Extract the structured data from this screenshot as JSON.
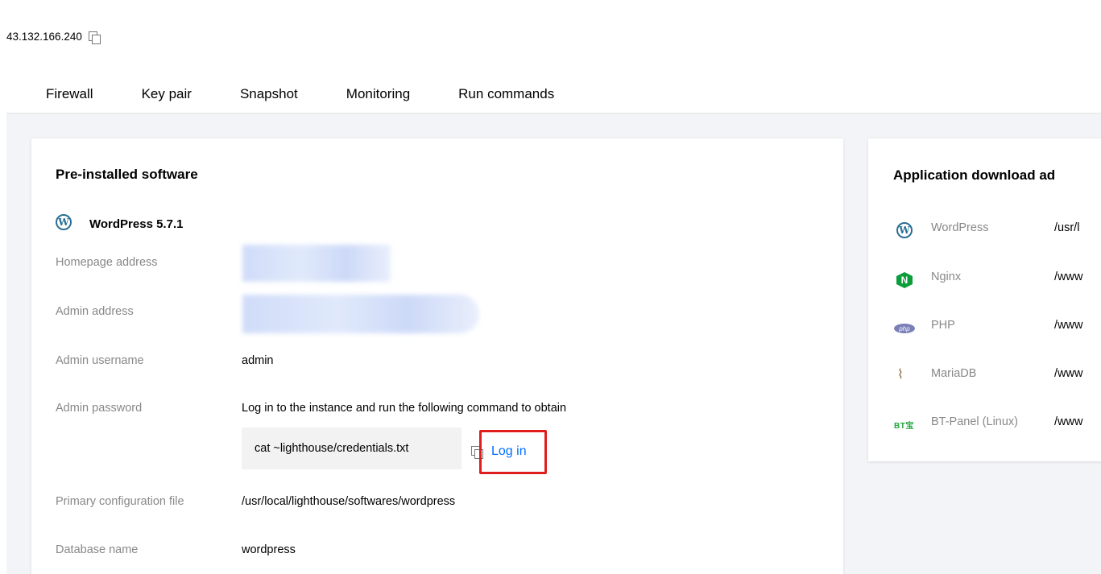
{
  "header": {
    "ip": "43.132.166.240",
    "tabs": [
      "Firewall",
      "Key pair",
      "Snapshot",
      "Monitoring",
      "Run commands"
    ]
  },
  "main": {
    "title": "Pre-installed software",
    "app": "WordPress 5.7.1",
    "labels": {
      "homepage": "Homepage address",
      "admin_address": "Admin address",
      "admin_username": "Admin username",
      "admin_password": "Admin password",
      "config": "Primary configuration file",
      "db_name": "Database name"
    },
    "values": {
      "admin_username": "admin",
      "password_hint": "Log in to the instance and run the following command to obtain",
      "command": "cat ~lighthouse/credentials.txt",
      "login": "Log in",
      "config": "/usr/local/lighthouse/softwares/wordpress",
      "db_name": "wordpress"
    }
  },
  "side": {
    "title": "Application download ad",
    "items": [
      {
        "name": "WordPress",
        "path": "/usr/l",
        "icon": "wordpress-icon"
      },
      {
        "name": "Nginx",
        "path": "/www",
        "icon": "nginx-icon"
      },
      {
        "name": "PHP",
        "path": "/www",
        "icon": "php-icon"
      },
      {
        "name": "MariaDB",
        "path": "/www",
        "icon": "mariadb-icon"
      },
      {
        "name": "BT-Panel (Linux)",
        "path": "/www",
        "icon": "bt-panel-icon"
      }
    ]
  },
  "icons": {
    "wp_glyph": "W",
    "nginx_glyph": "N",
    "php_glyph": "php",
    "maria_glyph": "⌇",
    "bt_glyph": "BT宝"
  },
  "colors": {
    "accent": "#006eff",
    "highlight_border": "#e01d1d",
    "page_bg": "#f3f4f7"
  }
}
